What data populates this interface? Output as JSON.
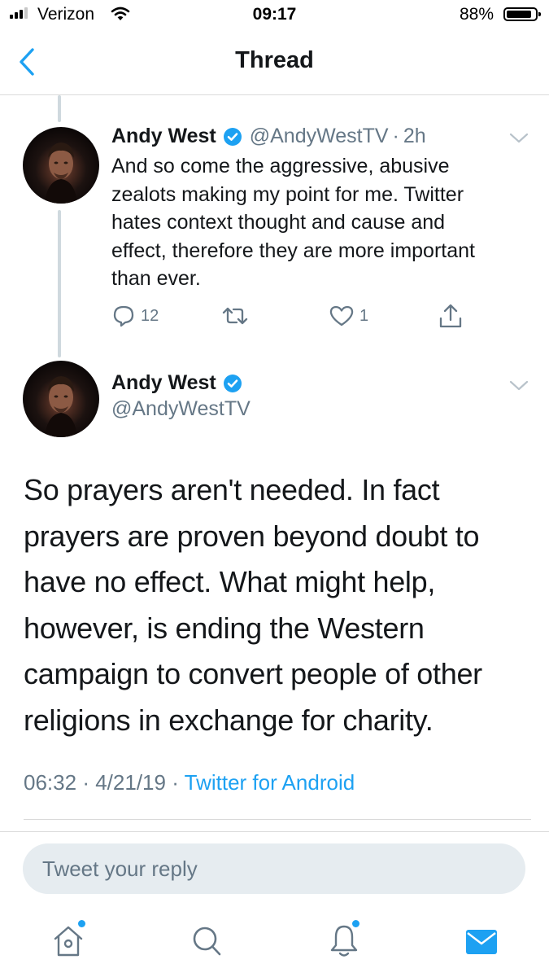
{
  "status": {
    "carrier": "Verizon",
    "time": "09:17",
    "battery": "88%",
    "battery_level": 0.88
  },
  "nav": {
    "title": "Thread",
    "back_icon": "chevron-left-icon"
  },
  "tweet1": {
    "name": "Andy West",
    "handle": "@AndyWestTV",
    "sep": "·",
    "age": "2h",
    "lines": [
      "And so come the aggressive, abusive",
      "zealots making my point for me. Twitter",
      "hates context thought and cause and",
      "effect, therefore they are more important",
      "than ever."
    ],
    "replies": "12",
    "likes": "1"
  },
  "tweet2": {
    "name": "Andy West",
    "handle": "@AndyWestTV",
    "lines": [
      "So prayers aren't needed. In fact",
      "prayers are proven beyond doubt to",
      "have no effect. What might help,",
      "however, is ending the Western",
      "campaign to convert people of other",
      "religions in exchange for charity."
    ],
    "time": "06:32",
    "sep1": "·",
    "date": "4/21/19",
    "sep2": "·",
    "source": "Twitter for Android"
  },
  "reply": {
    "placeholder": "Tweet your reply"
  },
  "tabs": [
    "home-icon",
    "search-icon",
    "notifications-icon",
    "messages-icon"
  ],
  "colors": {
    "accent": "#1da1f2",
    "secondary_text": "#657786",
    "reply_bg": "#e6ecf0"
  }
}
